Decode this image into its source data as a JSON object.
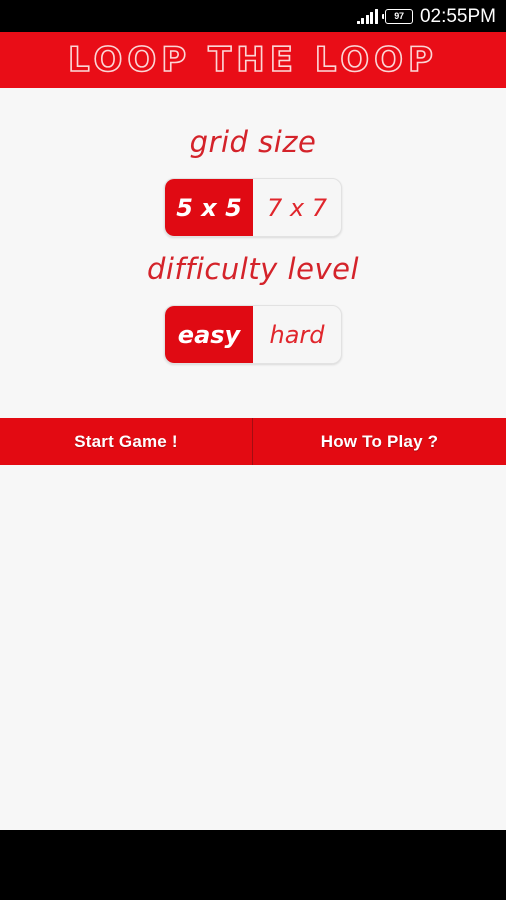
{
  "statusbar": {
    "signal_icon": "signal-bars-icon",
    "battery_icon": "battery-icon",
    "battery_level": "97",
    "time": "02:55PM"
  },
  "appbar": {
    "title": "LOOP THE LOOP"
  },
  "settings": {
    "grid_size": {
      "label": "grid size",
      "options": [
        {
          "label": "5 x 5",
          "selected": true
        },
        {
          "label": "7 x 7",
          "selected": false
        }
      ],
      "selected_value": "5 x 5"
    },
    "difficulty": {
      "label": "difficulty level",
      "options": [
        {
          "label": "easy",
          "selected": true
        },
        {
          "label": "hard",
          "selected": false
        }
      ],
      "selected_value": "easy"
    }
  },
  "actions": {
    "start_game": "Start Game !",
    "how_to_play": "How To Play ?"
  },
  "colors": {
    "brand_red": "#E90D17",
    "button_red": "#E30A12",
    "selected_red": "#E00A13",
    "label_red": "#D4232A",
    "page_background": "#F7F7F7",
    "system_black": "#000000"
  }
}
